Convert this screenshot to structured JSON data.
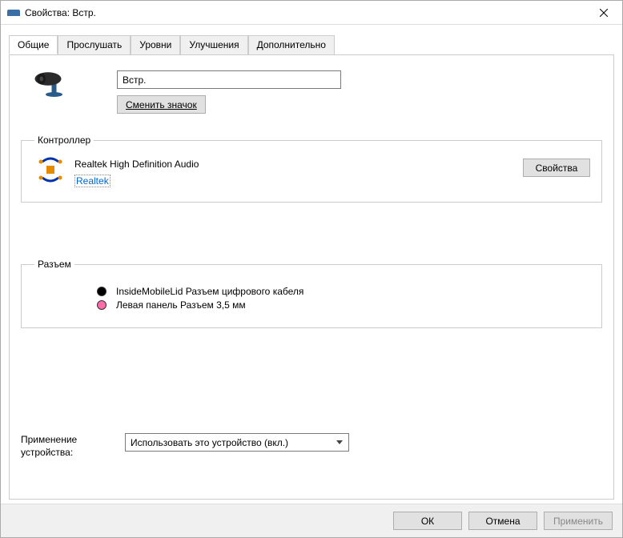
{
  "window": {
    "title": "Свойства: Встр."
  },
  "tabs": {
    "general": "Общие",
    "listen": "Прослушать",
    "levels": "Уровни",
    "enhancements": "Улучшения",
    "advanced": "Дополнительно"
  },
  "device": {
    "name_value": "Встр.",
    "change_icon_label": "Сменить значок"
  },
  "controller": {
    "legend": "Контроллер",
    "name": "Realtek High Definition Audio",
    "vendor": "Realtek",
    "properties_label": "Свойства"
  },
  "jack": {
    "legend": "Разъем",
    "items": [
      {
        "color": "black",
        "label": "InsideMobileLid Разъем цифрового кабеля"
      },
      {
        "color": "pink",
        "label": "Левая панель Разъем 3,5 мм"
      }
    ]
  },
  "usage": {
    "label": "Применение устройства:",
    "selected": "Использовать это устройство (вкл.)"
  },
  "footer": {
    "ok": "ОК",
    "cancel": "Отмена",
    "apply": "Применить"
  }
}
